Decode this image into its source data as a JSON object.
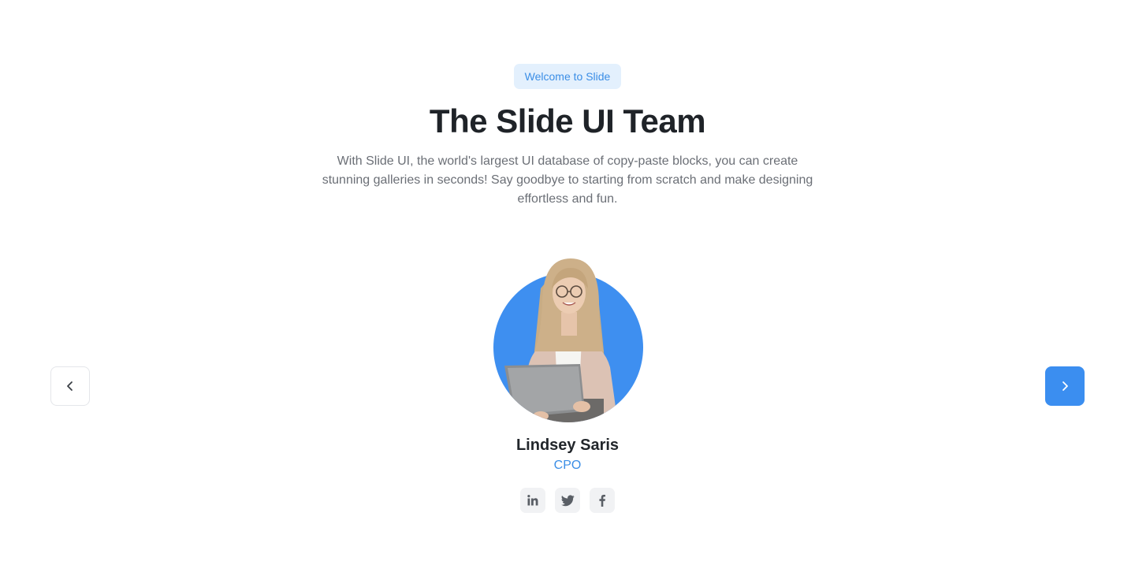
{
  "header": {
    "badge": "Welcome to Slide",
    "title": "The Slide UI Team",
    "subtitle": "With Slide UI, the world's largest UI database of copy-paste blocks, you can create stunning galleries in seconds! Say goodbye to starting from scratch and make designing effortless and fun."
  },
  "carousel": {
    "prev_icon": "chevron-left-icon",
    "next_icon": "chevron-right-icon",
    "member": {
      "name": "Lindsey Saris",
      "role": "CPO",
      "socials": [
        "linkedin-icon",
        "twitter-icon",
        "facebook-icon"
      ]
    }
  },
  "colors": {
    "accent": "#3b8ef0",
    "badge_bg": "#e3f0fd",
    "badge_text": "#3b8ee6",
    "title": "#1f2328",
    "body_text": "#6b6f76",
    "social_bg": "#f1f2f4"
  }
}
